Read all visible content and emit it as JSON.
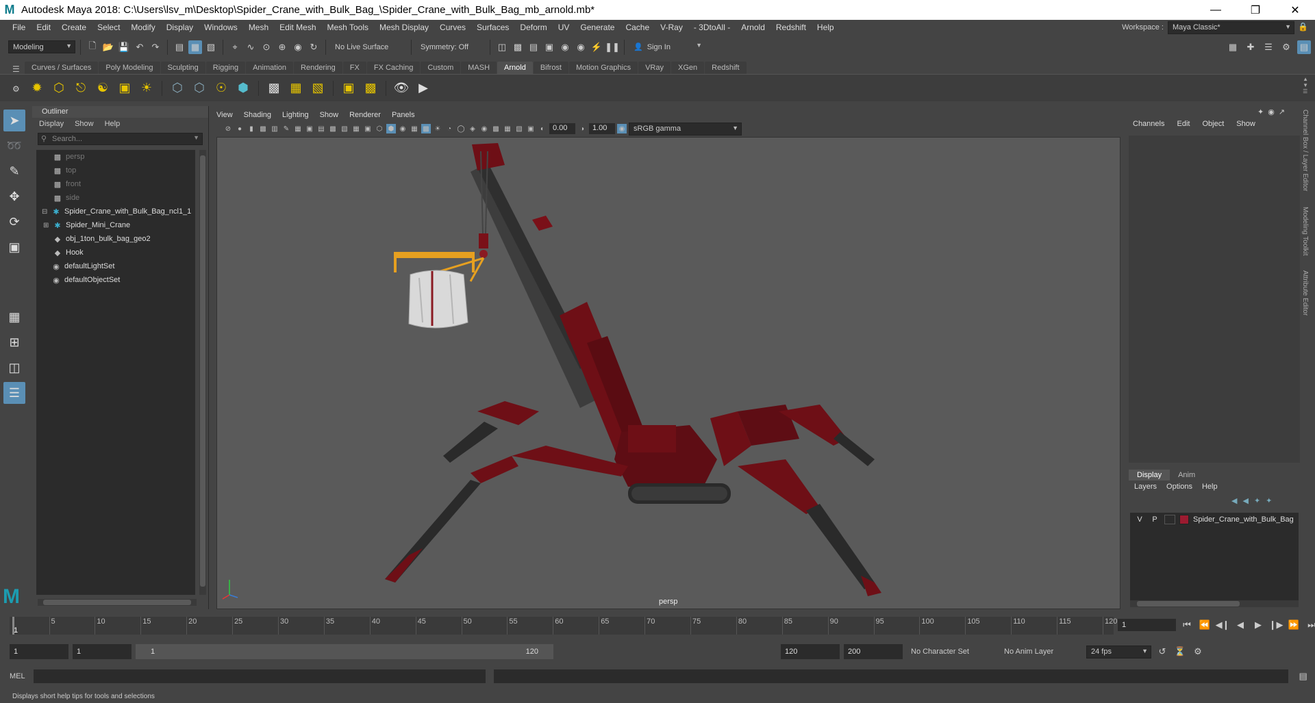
{
  "window": {
    "title": "Autodesk Maya 2018: C:\\Users\\lsv_m\\Desktop\\Spider_Crane_with_Bulk_Bag_\\Spider_Crane_with_Bulk_Bag_mb_arnold.mb*",
    "logo": "M"
  },
  "menubar": {
    "items": [
      "File",
      "Edit",
      "Create",
      "Select",
      "Modify",
      "Display",
      "Windows",
      "Mesh",
      "Edit Mesh",
      "Mesh Tools",
      "Mesh Display",
      "Curves",
      "Surfaces",
      "Deform",
      "UV",
      "Generate",
      "Cache",
      "V-Ray",
      "- 3DtoAll -",
      "Arnold",
      "Redshift",
      "Help"
    ],
    "workspace_label": "Workspace :",
    "workspace_value": "Maya Classic*"
  },
  "toolbar": {
    "mode": "Modeling",
    "live_surface": "No Live Surface",
    "symmetry": "Symmetry: Off",
    "sign_in": "Sign In"
  },
  "shelf": {
    "tabs": [
      "Curves / Surfaces",
      "Poly Modeling",
      "Sculpting",
      "Rigging",
      "Animation",
      "Rendering",
      "FX",
      "FX Caching",
      "Custom",
      "MASH",
      "Arnold",
      "Bifrost",
      "Motion Graphics",
      "VRay",
      "XGen",
      "Redshift"
    ],
    "selected": "Arnold"
  },
  "outliner": {
    "title": "Outliner",
    "menu": [
      "Display",
      "Show",
      "Help"
    ],
    "search_placeholder": "Search...",
    "items": [
      {
        "label": "persp",
        "icon": "camera-icon",
        "dim": true,
        "indent": 1
      },
      {
        "label": "top",
        "icon": "camera-icon",
        "dim": true,
        "indent": 1
      },
      {
        "label": "front",
        "icon": "camera-icon",
        "dim": true,
        "indent": 1
      },
      {
        "label": "side",
        "icon": "camera-icon",
        "dim": true,
        "indent": 1
      },
      {
        "label": "Spider_Crane_with_Bulk_Bag_ncl1_1",
        "icon": "joint-icon",
        "dim": false,
        "indent": 0
      },
      {
        "label": "Spider_Mini_Crane",
        "icon": "joint-icon",
        "dim": false,
        "indent": 1
      },
      {
        "label": "obj_1ton_bulk_bag_geo2",
        "icon": "mesh-icon",
        "dim": false,
        "indent": 1
      },
      {
        "label": "Hook",
        "icon": "mesh-icon",
        "dim": false,
        "indent": 1
      },
      {
        "label": "defaultLightSet",
        "icon": "set-icon",
        "dim": false,
        "indent": 0
      },
      {
        "label": "defaultObjectSet",
        "icon": "set-icon",
        "dim": false,
        "indent": 0
      }
    ]
  },
  "viewport": {
    "menu": [
      "View",
      "Shading",
      "Lighting",
      "Show",
      "Renderer",
      "Panels"
    ],
    "exposure": "0.00",
    "gamma": "1.00",
    "colorspace": "sRGB gamma",
    "camera": "persp"
  },
  "channelbox": {
    "menu": [
      "Channels",
      "Edit",
      "Object",
      "Show"
    ]
  },
  "right_tabs": [
    "Channel Box / Layer Editor",
    "Modeling Toolkit",
    "Attribute Editor"
  ],
  "layers": {
    "tabs": [
      "Display",
      "Anim"
    ],
    "selected": "Display",
    "menu": [
      "Layers",
      "Options",
      "Help"
    ],
    "layer": {
      "v": "V",
      "p": "P",
      "name": "Spider_Crane_with_Bulk_Bag",
      "color": "#9b1b30"
    }
  },
  "timeline": {
    "ticks": [
      "5",
      "10",
      "15",
      "20",
      "25",
      "30",
      "35",
      "40",
      "45",
      "50",
      "55",
      "60",
      "65",
      "70",
      "75",
      "80",
      "85",
      "90",
      "95",
      "100",
      "105",
      "110",
      "115",
      "120"
    ],
    "current": "1",
    "current_field": "1"
  },
  "range": {
    "start": "1",
    "start2": "1",
    "slider_start": "1",
    "slider_end": "120",
    "end": "120",
    "end2": "200",
    "char_set": "No Character Set",
    "anim_layer": "No Anim Layer",
    "fps": "24 fps"
  },
  "mel": {
    "label": "MEL"
  },
  "help": {
    "text": "Displays short help tips for tools and selections"
  },
  "colors": {
    "accent": "#5a8fb5",
    "crane": "#6e0f16",
    "bag": "#d9d9d9",
    "spreader": "#e6a020"
  }
}
